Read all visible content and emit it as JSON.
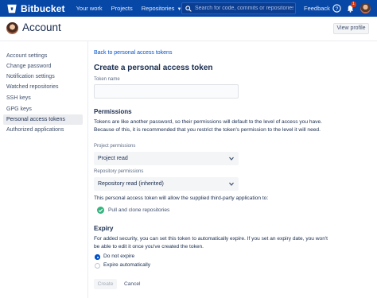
{
  "topnav": {
    "brand": "Bitbucket",
    "items": [
      "Your work",
      "Projects",
      "Repositories"
    ],
    "search_placeholder": "Search for code, commits or repositories...",
    "feedback": "Feedback",
    "notification_count": "1",
    "colors": {
      "bar": "#0747a6",
      "text": "#deebff"
    }
  },
  "header": {
    "title": "Account",
    "view_profile": "View profile"
  },
  "sidebar": {
    "items": [
      "Account settings",
      "Change password",
      "Notification settings",
      "Watched repositories",
      "SSH keys",
      "GPG keys",
      "Personal access tokens",
      "Authorized applications"
    ],
    "active": "Personal access tokens"
  },
  "main": {
    "back_link": "Back to personal access tokens",
    "page_title": "Create a personal access token",
    "token_name_label": "Token name",
    "token_name_value": "",
    "permissions_heading": "Permissions",
    "permissions_text": "Tokens are like another password, so their permissions will default to the level of access you have. Because of this, it is recommended that you restrict the token's permission to the level it will need.",
    "project_permissions_label": "Project permissions",
    "project_permissions_value": "Project read",
    "repository_permissions_label": "Repository permissions",
    "repository_permissions_value": "Repository read (inherited)",
    "allow_text": "This personal access token will allow the supplied third-party application to:",
    "allowed_action": "Pull and clone repositories",
    "expiry_heading": "Expiry",
    "expiry_text": "For added security, you can set this token to automatically expire. If you set an expiry date, you won't be able to edit it once you've created the token.",
    "expiry_options": [
      "Do not expire",
      "Expire automatically"
    ],
    "expiry_selected": "Do not expire",
    "create_label": "Create",
    "cancel_label": "Cancel"
  }
}
